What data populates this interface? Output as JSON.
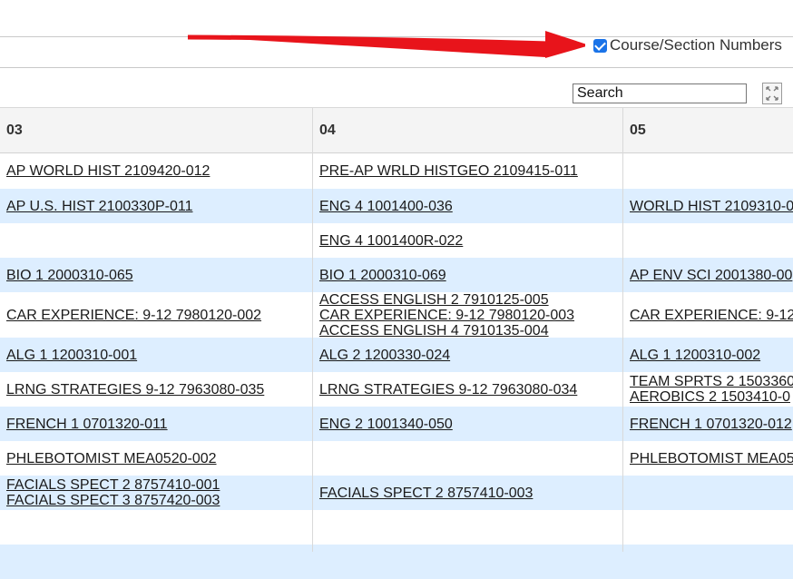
{
  "options": {
    "course_section_numbers_label": "Course/Section Numbers",
    "checked": true
  },
  "search": {
    "placeholder": "Search"
  },
  "columns": [
    "03",
    "04",
    "05"
  ],
  "rows": [
    [
      [
        "AP WORLD HIST 2109420-012"
      ],
      [
        "PRE-AP WRLD HISTGEO 2109415-011"
      ],
      []
    ],
    [
      [
        "AP U.S. HIST 2100330P-011"
      ],
      [
        "ENG 4 1001400-036"
      ],
      [
        "WORLD HIST 2109310-0"
      ]
    ],
    [
      [],
      [
        "ENG 4 1001400R-022"
      ],
      []
    ],
    [
      [
        "BIO 1 2000310-065"
      ],
      [
        "BIO 1 2000310-069"
      ],
      [
        "AP ENV SCI 2001380-00"
      ]
    ],
    [
      [
        "CAR EXPERIENCE: 9-12 7980120-002"
      ],
      [
        "ACCESS ENGLISH 2 7910125-005",
        "CAR EXPERIENCE: 9-12 7980120-003",
        "ACCESS ENGLISH 4 7910135-004"
      ],
      [
        "CAR EXPERIENCE: 9-12"
      ]
    ],
    [
      [
        "ALG 1 1200310-001"
      ],
      [
        "ALG 2 1200330-024"
      ],
      [
        "ALG 1 1200310-002"
      ]
    ],
    [
      [
        "LRNG STRATEGIES 9-12 7963080-035"
      ],
      [
        "LRNG STRATEGIES 9-12 7963080-034"
      ],
      [
        "TEAM SPRTS 2 1503360",
        "AEROBICS 2 1503410-0"
      ]
    ],
    [
      [
        "FRENCH 1 0701320-011"
      ],
      [
        "ENG 2 1001340-050"
      ],
      [
        "FRENCH 1 0701320-012"
      ]
    ],
    [
      [
        "PHLEBOTOMIST MEA0520-002"
      ],
      [],
      [
        "PHLEBOTOMIST MEA05"
      ]
    ],
    [
      [
        "FACIALS SPECT 2 8757410-001",
        "FACIALS SPECT 3 8757420-003"
      ],
      [
        "FACIALS SPECT 2 8757410-003"
      ],
      []
    ],
    [
      [],
      [],
      []
    ],
    [
      [],
      [],
      []
    ]
  ],
  "colors": {
    "row_alt": "#ddeeff",
    "row_base": "#ffffff",
    "header_bg": "#f4f4f4",
    "arrow": "#e8141b",
    "checkbox": "#1a73e8"
  },
  "icons": {
    "expand": "expand-arrows-icon",
    "arrow": "red-arrow-annotation-icon"
  }
}
